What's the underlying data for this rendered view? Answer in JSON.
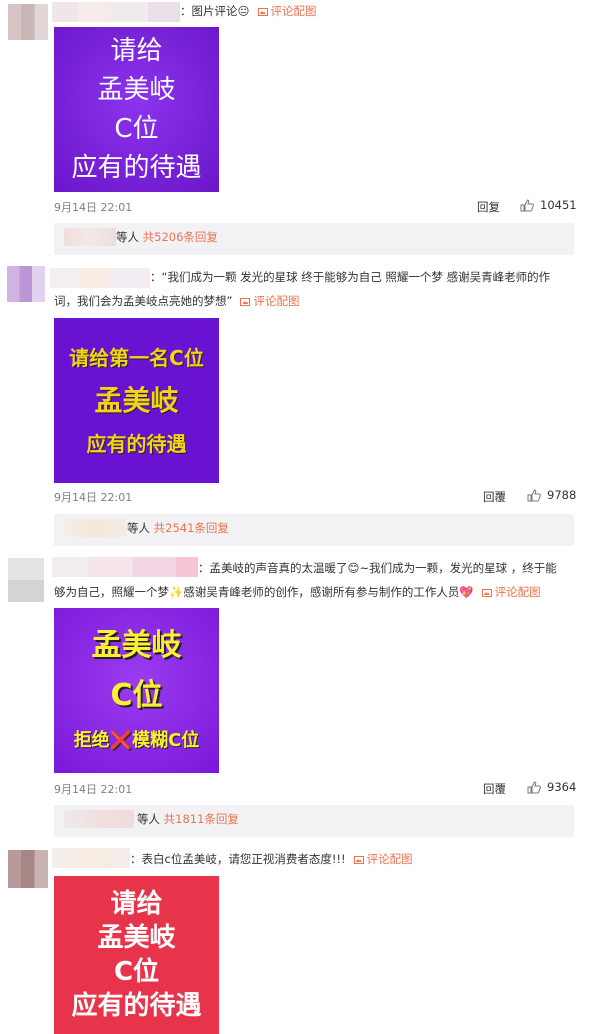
{
  "comments": [
    {
      "text": "：图片评论😐",
      "pic_link": "评论配图",
      "image_lines": [
        "请给",
        "孟美岐",
        "C位",
        "应有的待遇"
      ],
      "image_colors": {
        "bg": "#7a1fe0",
        "fg": "#ffffff"
      },
      "time": "9月14日 22:01",
      "reply_label": "回复",
      "likes": "10451",
      "reply_summary": {
        "prefix": "等人",
        "count_text": "共5206条回复"
      }
    },
    {
      "text_line1": "：“我们成为一颗 发光的星球 终于能够为自己 照耀一个梦 感谢吴青峰老师的作",
      "text_line2": "词，我们会为孟美岐点亮她的梦想”",
      "pic_link": "评论配图",
      "image_lines": [
        "请给第一名C位",
        "孟美岐",
        "应有的待遇"
      ],
      "image_colors": {
        "bg": "#6a0fd0",
        "fg": "#f2d21a"
      },
      "time": "9月14日 22:01",
      "reply_label": "回覆",
      "likes": "9788",
      "reply_summary": {
        "prefix": "等人",
        "count_text": "共2541条回复"
      }
    },
    {
      "text_line1": "：孟美岐的声音真的太温暖了😊~我们成为一颗，发光的星球 ，终于能",
      "text_line2": "够为自己，照耀一个梦✨感谢吴青峰老师的创作，感谢所有参与制作的工作人员💖",
      "pic_link": "评论配图",
      "image_lines": [
        "孟美岐",
        "C位",
        "拒绝❌模糊C位"
      ],
      "image_colors": {
        "bg": "#8a22e8",
        "fg": "#ffef33"
      },
      "time": "9月14日 22:01",
      "reply_label": "回覆",
      "likes": "9364",
      "reply_summary": {
        "prefix": "等人",
        "count_text": "共1811条回复"
      }
    },
    {
      "text": "：表白c位孟美岐，请您正视消费者态度!!!",
      "pic_link": "评论配图",
      "image_lines": [
        "请给",
        "孟美岐",
        "C位",
        "应有的待遇"
      ],
      "image_colors": {
        "bg": "#e8344a",
        "fg": "#ffffff"
      }
    }
  ],
  "colors": {
    "link": "#eb7350",
    "meta": "#808080",
    "reply_bar": "#f2f2f5"
  },
  "icons": {
    "thumb": "thumbs-up-icon",
    "picture": "picture-icon"
  }
}
